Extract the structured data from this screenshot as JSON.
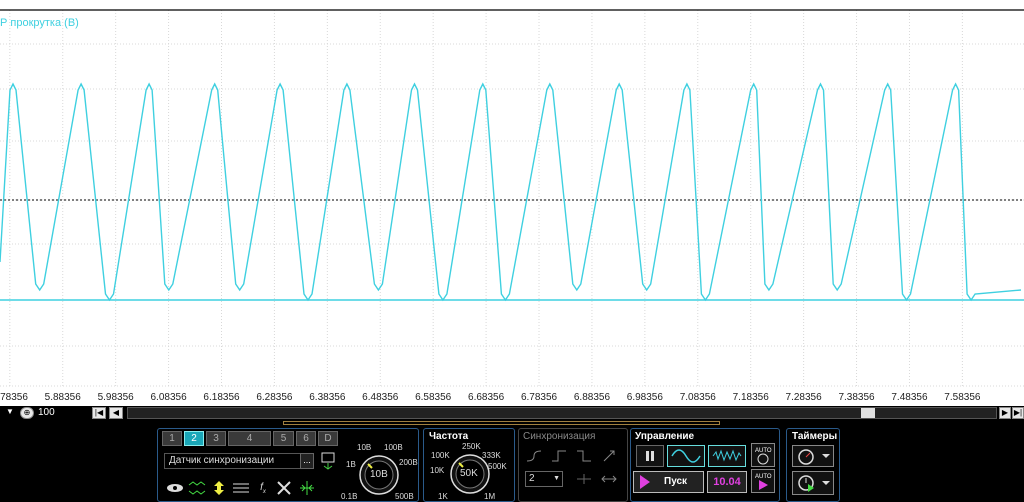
{
  "colors": {
    "trace": "#3fd0e0",
    "accent": "#1aa7b8",
    "time_value": "#e040e0",
    "play": "#e040e0"
  },
  "plot": {
    "channel_label": "Р прокрутка (В)",
    "x_ticks": [
      "5.78356",
      "5.88356",
      "5.98356",
      "6.08356",
      "6.18356",
      "6.28356",
      "6.38356",
      "6.48356",
      "6.58356",
      "6.68356",
      "6.78356",
      "6.88356",
      "6.98356",
      "7.08356",
      "7.18356",
      "7.28356",
      "7.38356",
      "7.48356",
      "7.58356"
    ]
  },
  "chart_data": {
    "type": "line",
    "title": "Р прокрутка (В)",
    "xlabel": "",
    "ylabel": "",
    "x_ticks": [
      5.78356,
      5.88356,
      5.98356,
      6.08356,
      6.18356,
      6.28356,
      6.38356,
      6.48356,
      6.58356,
      6.68356,
      6.78356,
      6.88356,
      6.98356,
      7.08356,
      7.18356,
      7.28356,
      7.38356,
      7.48356,
      7.58356
    ],
    "xlim": [
      5.765,
      7.7
    ],
    "grid": true,
    "series": [
      {
        "values_note": "",
        "peaks_x": [
          5.7895,
          5.9183,
          6.0468,
          6.1708,
          6.2942,
          6.4205,
          6.5483,
          6.6773,
          6.804,
          6.9351,
          7.063,
          7.1893,
          7.3154,
          7.4424,
          7.5708
        ],
        "troughs_x": [
          5.84,
          5.972,
          6.084,
          6.218,
          6.347,
          6.48,
          6.602,
          6.72,
          6.855,
          6.987,
          7.098,
          7.218,
          7.347,
          7.478,
          7.6
        ]
      }
    ]
  },
  "scrollbar": {
    "zoom_value": "100"
  },
  "panel": {
    "tabs": [
      "1",
      "2",
      "3",
      "4",
      "5",
      "6",
      "D"
    ],
    "sync_source": "Датчик синхронизации",
    "sync_source_btn": "...",
    "volt_knob": {
      "value": "10В",
      "labels": [
        "10В",
        "100В",
        "1В",
        "200В",
        "0.1В",
        "500В"
      ]
    },
    "freq_group": {
      "title": "Частота",
      "value": "50K",
      "labels": [
        "250K",
        "100K",
        "333K",
        "10K",
        "500K",
        "1K",
        "1M"
      ]
    },
    "sync_group": {
      "title": "Синхронизация",
      "channel": "2"
    },
    "control_group": {
      "title": "Управление",
      "start_label": "Пуск",
      "time_value": "10.04",
      "auto_label": "АUTO"
    },
    "timers_group": {
      "title": "Таймеры"
    }
  }
}
